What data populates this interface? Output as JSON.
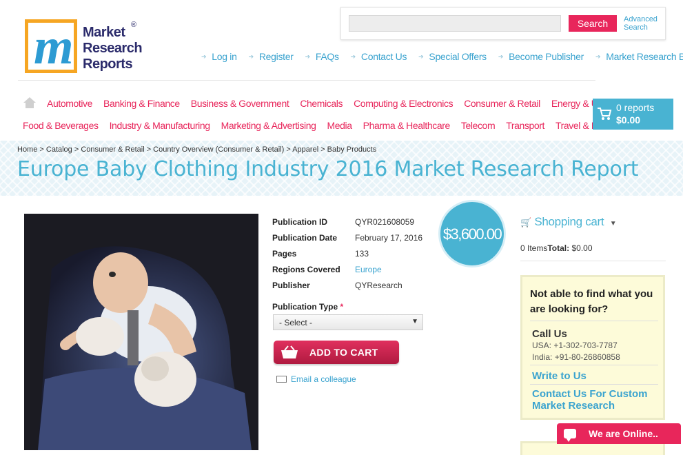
{
  "logo": {
    "letter": "m",
    "line1": "Market",
    "line2": "Research",
    "line3": "Reports",
    "reg": "®"
  },
  "search": {
    "placeholder": "",
    "button": "Search",
    "advanced_line1": "Advanced",
    "advanced_line2": "Search"
  },
  "toplinks": [
    "Log in",
    "Register",
    "FAQs",
    "Contact Us",
    "Special Offers",
    "Become Publisher",
    "Market Research Blog"
  ],
  "nav": {
    "row1": [
      "Automotive",
      "Banking & Finance",
      "Business & Government",
      "Chemicals",
      "Computing & Electronics",
      "Consumer & Retail",
      "Energy & Utilities"
    ],
    "row2": [
      "Food & Beverages",
      "Industry & Manufacturing",
      "Marketing & Advertising",
      "Media",
      "Pharma & Healthcare",
      "Telecom",
      "Transport",
      "Travel & Leisure"
    ]
  },
  "cart": {
    "count": "0 reports",
    "total": "$0.00"
  },
  "breadcrumb": "Home > Catalog > Consumer & Retail > Country Overview (Consumer & Retail) > Apparel > Baby Products",
  "title": "Europe Baby Clothing Industry 2016 Market Research Report",
  "details": [
    {
      "label": "Publication ID",
      "value": "QYR021608059"
    },
    {
      "label": "Publication Date",
      "value": "February 17, 2016"
    },
    {
      "label": "Pages",
      "value": "133"
    },
    {
      "label": "Regions Covered",
      "value": "Europe"
    },
    {
      "label": "Publisher",
      "value": "QYResearch"
    }
  ],
  "price": "$3,600.00",
  "pub_type": {
    "label": "Publication Type",
    "required": "*",
    "selected": "- Select -"
  },
  "add_to_cart": "ADD TO CART",
  "email_colleague": "Email a colleague",
  "shopping_cart": {
    "title": "Shopping cart",
    "items_label": "0 Items",
    "total_label": "Total:",
    "total_value": " $0.00"
  },
  "help": {
    "heading": "Not able to find what you are looking for?",
    "call_us": "Call Us",
    "usa": "USA: +1-302-703-7787",
    "india": "India: +91-80-26860858",
    "write": "Write to Us",
    "custom_line1": "Contact Us For Custom",
    "custom_line2": "Market Research"
  },
  "online": "We are Online.."
}
